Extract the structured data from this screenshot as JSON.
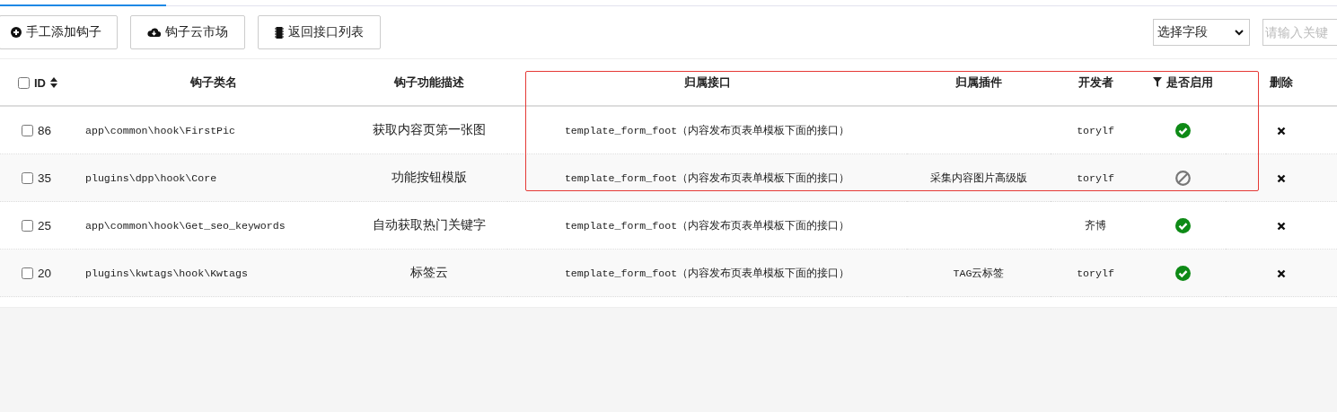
{
  "toolbar": {
    "buttons": [
      {
        "kind": "add",
        "label": "手工添加钩子"
      },
      {
        "kind": "cloud",
        "label": "钩子云市场"
      },
      {
        "kind": "back",
        "label": "返回接口列表"
      }
    ],
    "field_select": {
      "value": "选择字段"
    },
    "search": {
      "placeholder": "请输入关键"
    }
  },
  "table": {
    "select_all": {
      "checked": false
    },
    "columns": [
      {
        "kind": "id",
        "label": "ID"
      },
      {
        "kind": "text",
        "label": "钩子类名"
      },
      {
        "kind": "text",
        "label": "钩子功能描述"
      },
      {
        "kind": "text",
        "label": "归属接口"
      },
      {
        "kind": "text",
        "label": "归属插件"
      },
      {
        "kind": "text",
        "label": "开发者"
      },
      {
        "kind": "filter",
        "label": "是否启用"
      },
      {
        "kind": "text",
        "label": "删除"
      }
    ],
    "rows": [
      {
        "checked": false,
        "id": "86",
        "class_name": "app\\common\\hook\\FirstPic",
        "description": "获取内容页第一张图",
        "interface": "template_form_foot（内容发布页表单模板下面的接口）",
        "plugin": "",
        "developer": "torylf",
        "enabled": true
      },
      {
        "checked": false,
        "id": "35",
        "class_name": "plugins\\dpp\\hook\\Core",
        "description": "功能按钮模版",
        "interface": "template_form_foot（内容发布页表单模板下面的接口）",
        "plugin": "采集内容图片高级版",
        "developer": "torylf",
        "enabled": false
      },
      {
        "checked": false,
        "id": "25",
        "class_name": "app\\common\\hook\\Get_seo_keywords",
        "description": "自动获取热门关键字",
        "interface": "template_form_foot（内容发布页表单模板下面的接口）",
        "plugin": "",
        "developer": "齐博",
        "enabled": true
      },
      {
        "checked": false,
        "id": "20",
        "class_name": "plugins\\kwtags\\hook\\Kwtags",
        "description": "标签云",
        "interface": "template_form_foot（内容发布页表单模板下面的接口）",
        "plugin": "TAG云标签",
        "developer": "torylf",
        "enabled": true
      }
    ]
  }
}
